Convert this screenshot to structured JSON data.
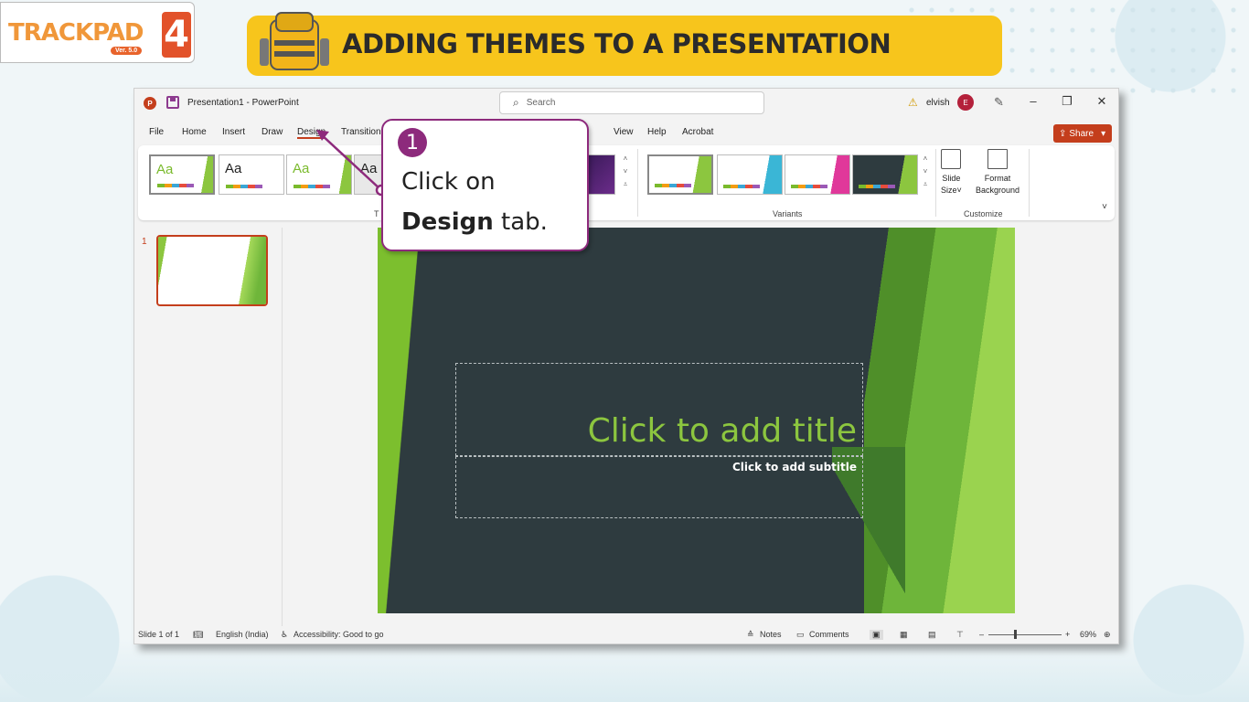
{
  "logo": {
    "text": "TRACKPAD",
    "number": "4",
    "version": "Ver. 5.0"
  },
  "banner": {
    "title": "ADDING THEMES TO A PRESENTATION"
  },
  "window": {
    "title": "Presentation1 - PowerPoint",
    "search_placeholder": "Search",
    "user_name": "elvish",
    "user_initial": "E"
  },
  "tabs": [
    "File",
    "Home",
    "Insert",
    "Draw",
    "Design",
    "Transition",
    "View",
    "Help",
    "Acrobat"
  ],
  "share_label": "Share",
  "ribbon": {
    "theme_aa": "Aa",
    "themes_group_label": "T",
    "variants_label": "Variants",
    "customize_label": "Customize",
    "slide_size_label_1": "Slide",
    "slide_size_label_2": "Size",
    "format_bg_label_1": "Format",
    "format_bg_label_2": "Background"
  },
  "slide_pane": {
    "slide_number": "1"
  },
  "slide": {
    "title_placeholder": "Click to add title",
    "subtitle_placeholder": "Click to add subtitle"
  },
  "status": {
    "slide_of": "Slide 1 of 1",
    "language": "English (India)",
    "accessibility": "Accessibility: Good to go",
    "notes": "Notes",
    "comments": "Comments",
    "zoom": "69%"
  },
  "callout": {
    "step": "1",
    "line1": "Click on",
    "line2_bold": "Design",
    "line2_rest": " tab."
  },
  "colors": {
    "accent": "#c43e1c",
    "banner": "#f7c51c",
    "callout_border": "#8d2a7c",
    "slide_bg": "#2e3b3f",
    "title_green": "#8cc63f"
  }
}
